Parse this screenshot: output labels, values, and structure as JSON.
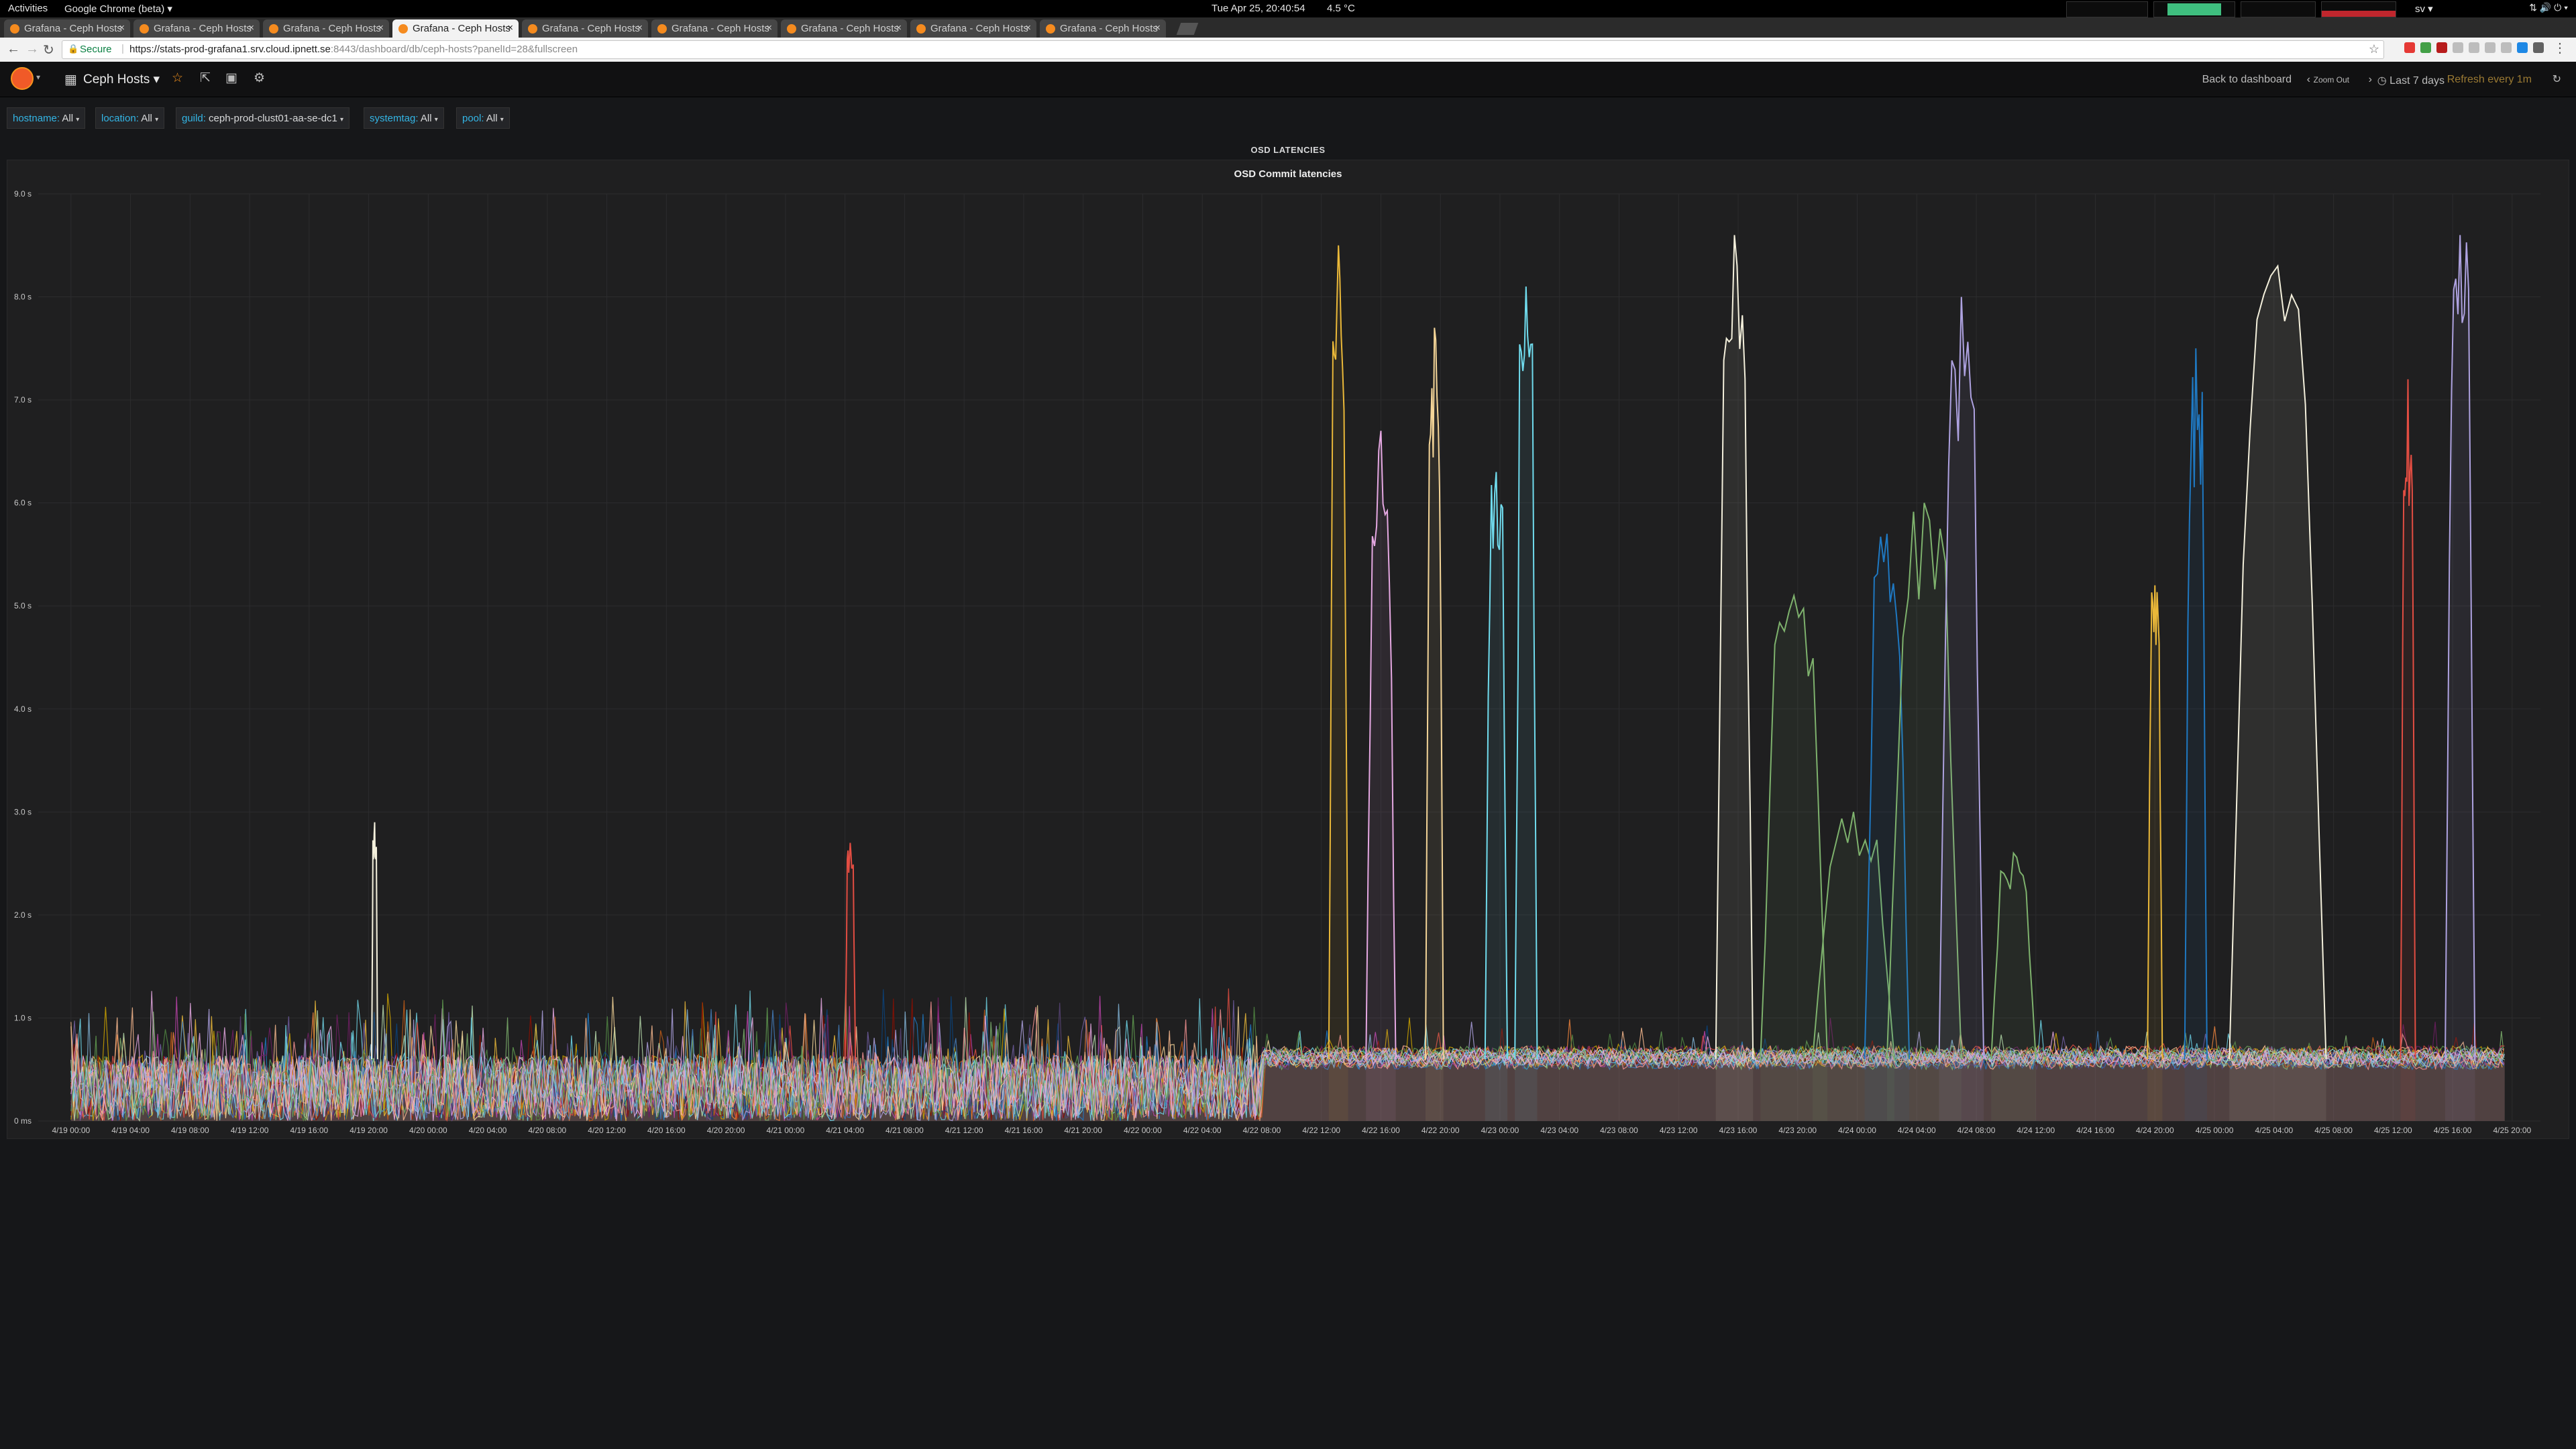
{
  "topbar": {
    "activities": "Activities",
    "app_menu": "Google Chrome (beta) ▾",
    "clock": "Tue Apr 25, 20:40:54",
    "temperature": "4.5 °C",
    "keyboard_layout": "sv ▾"
  },
  "tabs": [
    {
      "label": "Grafana - Ceph Hosts",
      "active": false
    },
    {
      "label": "Grafana - Ceph Hosts",
      "active": false
    },
    {
      "label": "Grafana - Ceph Hosts",
      "active": false
    },
    {
      "label": "Grafana - Ceph Hosts",
      "active": true
    },
    {
      "label": "Grafana - Ceph Hosts",
      "active": false
    },
    {
      "label": "Grafana - Ceph Hosts",
      "active": false
    },
    {
      "label": "Grafana - Ceph Hosts",
      "active": false
    },
    {
      "label": "Grafana - Ceph Hosts",
      "active": false
    },
    {
      "label": "Grafana - Ceph Hosts",
      "active": false
    }
  ],
  "address_bar": {
    "secure_label": "Secure",
    "url_host": "https://stats-prod-grafana1.srv.cloud.ipnett.se",
    "url_path": ":8443/dashboard/db/ceph-hosts?panelId=28&fullscreen"
  },
  "grafana": {
    "dashboard_title": "Ceph Hosts ▾",
    "back_to_dashboard": "Back to dashboard",
    "zoom_out": "Zoom Out",
    "time_range": "Last 7 days",
    "refresh": "Refresh every 1m",
    "colors": {
      "accent": "#f7941d",
      "variable_label": "#33b5e5",
      "background": "#161719",
      "panel": "#1f1f20"
    }
  },
  "variables": [
    {
      "label": "hostname:",
      "value": "All"
    },
    {
      "label": "location:",
      "value": "All"
    },
    {
      "label": "guild:",
      "value": "ceph-prod-clust01-aa-se-dc1"
    },
    {
      "label": "systemtag:",
      "value": "All"
    },
    {
      "label": "pool:",
      "value": "All"
    }
  ],
  "row_title": "OSD LATENCIES",
  "chart_data": {
    "type": "line",
    "title": "OSD Commit latencies",
    "xlabel": "",
    "ylabel": "",
    "ylim": [
      0,
      9
    ],
    "y_unit": "s",
    "y_ticks": [
      "0 ms",
      "1.0 s",
      "2.0 s",
      "3.0 s",
      "4.0 s",
      "5.0 s",
      "6.0 s",
      "7.0 s",
      "8.0 s",
      "9.0 s"
    ],
    "x_ticks": [
      "4/19 00:00",
      "4/19 04:00",
      "4/19 08:00",
      "4/19 12:00",
      "4/19 16:00",
      "4/19 20:00",
      "4/20 00:00",
      "4/20 04:00",
      "4/20 08:00",
      "4/20 12:00",
      "4/20 16:00",
      "4/20 20:00",
      "4/21 00:00",
      "4/21 04:00",
      "4/21 08:00",
      "4/21 12:00",
      "4/21 16:00",
      "4/21 20:00",
      "4/22 00:00",
      "4/22 04:00",
      "4/22 08:00",
      "4/22 12:00",
      "4/22 16:00",
      "4/22 20:00",
      "4/23 00:00",
      "4/23 04:00",
      "4/23 08:00",
      "4/23 12:00",
      "4/23 16:00",
      "4/23 20:00",
      "4/24 00:00",
      "4/24 04:00",
      "4/24 08:00",
      "4/24 12:00",
      "4/24 16:00",
      "4/24 20:00",
      "4/25 00:00",
      "4/25 04:00",
      "4/25 08:00",
      "4/25 12:00",
      "4/25 16:00",
      "4/25 20:00"
    ],
    "x_range_hours": [
      -2.2,
      165.9
    ],
    "grid": true,
    "legend": "none",
    "series_colors": [
      "#7eb26d",
      "#eab839",
      "#6ed0e0",
      "#ef843c",
      "#e24d42",
      "#1f78c1",
      "#ba43a9",
      "#705da0",
      "#508642",
      "#cca300",
      "#447ebc",
      "#c15c17",
      "#890f02",
      "#0a437c",
      "#6d1f62",
      "#584477",
      "#b7dbab",
      "#f4d598",
      "#70dbed",
      "#f9ba8f",
      "#f29191",
      "#82b5d8",
      "#e5a8e2",
      "#aea2e0",
      "#629e51"
    ],
    "baseline_band": {
      "before_hours": [
        0.4,
        0.7
      ],
      "after_hours": [
        0.5,
        0.75
      ],
      "change_at_hours": 80
    },
    "spikes": [
      {
        "color": "#eab839",
        "start_h": 84.5,
        "end_h": 85.8,
        "peak_s": 8.5
      },
      {
        "color": "#e5a8e2",
        "start_h": 87.0,
        "end_h": 89.0,
        "peak_s": 6.7
      },
      {
        "color": "#f4d598",
        "start_h": 91.0,
        "end_h": 92.2,
        "peak_s": 7.7
      },
      {
        "color": "#70dbed",
        "start_h": 95.0,
        "end_h": 96.5,
        "peak_s": 6.3
      },
      {
        "color": "#70dbed",
        "start_h": 97.0,
        "end_h": 98.5,
        "peak_s": 8.1
      },
      {
        "color": "#f4f0dc",
        "start_h": 110.5,
        "end_h": 113.0,
        "peak_s": 8.6
      },
      {
        "color": "#7eb26d",
        "start_h": 113.5,
        "end_h": 118.0,
        "peak_s": 5.1
      },
      {
        "color": "#7eb26d",
        "start_h": 117.0,
        "end_h": 122.5,
        "peak_s": 3.0
      },
      {
        "color": "#1f78c1",
        "start_h": 120.5,
        "end_h": 123.5,
        "peak_s": 5.7
      },
      {
        "color": "#7eb26d",
        "start_h": 122.0,
        "end_h": 127.0,
        "peak_s": 6.0
      },
      {
        "color": "#aea2e0",
        "start_h": 125.5,
        "end_h": 128.5,
        "peak_s": 8.0
      },
      {
        "color": "#7eb26d",
        "start_h": 129.0,
        "end_h": 132.0,
        "peak_s": 2.6
      },
      {
        "color": "#eab839",
        "start_h": 139.5,
        "end_h": 140.5,
        "peak_s": 5.2
      },
      {
        "color": "#1f78c1",
        "start_h": 142.0,
        "end_h": 143.5,
        "peak_s": 7.5
      },
      {
        "color": "#f4f0dc",
        "start_h": 145.0,
        "end_h": 151.5,
        "peak_s": 8.3
      },
      {
        "color": "#e24d42",
        "start_h": 156.5,
        "end_h": 157.5,
        "peak_s": 7.2
      },
      {
        "color": "#aea2e0",
        "start_h": 159.5,
        "end_h": 161.5,
        "peak_s": 8.6
      },
      {
        "color": "#f4f0dc",
        "start_h": 20.2,
        "end_h": 20.6,
        "peak_s": 2.9
      },
      {
        "color": "#e24d42",
        "start_h": 52.0,
        "end_h": 52.7,
        "peak_s": 2.7
      }
    ]
  }
}
